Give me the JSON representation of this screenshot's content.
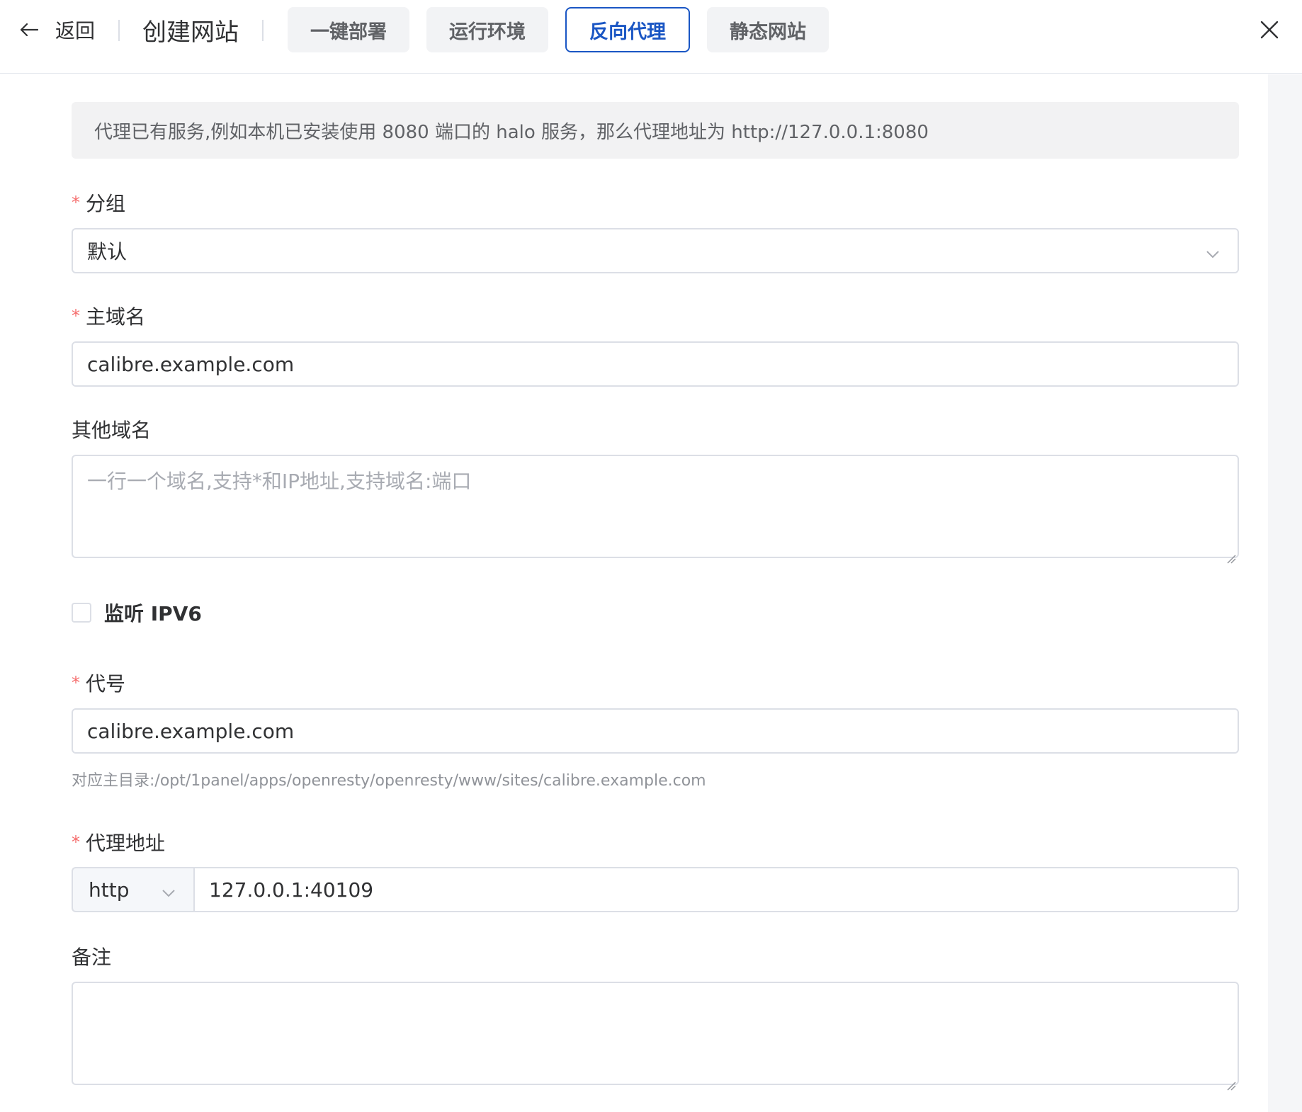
{
  "header": {
    "back_label": "返回",
    "title": "创建网站",
    "tabs": [
      {
        "label": "一键部署"
      },
      {
        "label": "运行环境"
      },
      {
        "label": "反向代理",
        "active": true
      },
      {
        "label": "静态网站"
      }
    ]
  },
  "tip": "代理已有服务,例如本机已安装使用 8080 端口的 halo 服务，那么代理地址为 http://127.0.0.1:8080",
  "form": {
    "group": {
      "label": "分组",
      "value": "默认"
    },
    "primary_domain": {
      "label": "主域名",
      "value": "calibre.example.com"
    },
    "other_domains": {
      "label": "其他域名",
      "placeholder": "一行一个域名,支持*和IP地址,支持域名:端口"
    },
    "ipv6": {
      "label": "监听 IPV6",
      "checked": false
    },
    "alias": {
      "label": "代号",
      "value": "calibre.example.com",
      "hint": "对应主目录:/opt/1panel/apps/openresty/openresty/www/sites/calibre.example.com"
    },
    "proxy": {
      "label": "代理地址",
      "scheme": "http",
      "address": "127.0.0.1:40109"
    },
    "remark": {
      "label": "备注",
      "value": ""
    }
  },
  "colors": {
    "accent": "#1a56c4",
    "required": "#f56c6c"
  },
  "icons": {
    "back": "arrow-left-icon",
    "close": "close-icon",
    "dropdown": "chevron-down-icon"
  }
}
